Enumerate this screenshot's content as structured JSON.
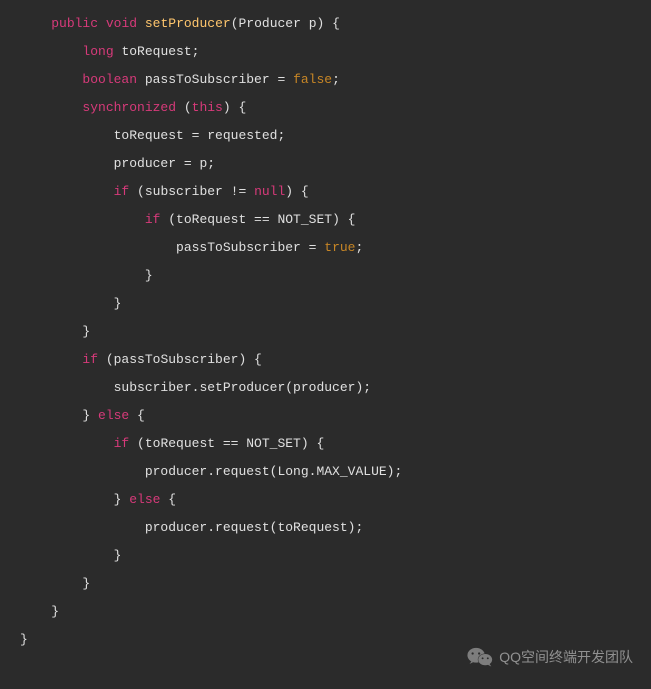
{
  "code": {
    "l1_public": "public",
    "l1_void": "void",
    "l1_method": "setProducer",
    "l1_params": "(Producer p) {",
    "l2_long": "long",
    "l2_rest": " toRequest;",
    "l3_boolean": "boolean",
    "l3_rest": " passToSubscriber = ",
    "l3_false": "false",
    "l3_semi": ";",
    "l4_sync": "synchronized",
    "l4_rest1": " (",
    "l4_this": "this",
    "l4_rest2": ") {",
    "l5": "toRequest = requested;",
    "l6": "producer = p;",
    "l7_if": "if",
    "l7_rest1": " (subscriber != ",
    "l7_null": "null",
    "l7_rest2": ") {",
    "l8_if": "if",
    "l8_rest": " (toRequest == NOT_SET) {",
    "l9_rest1": "passToSubscriber = ",
    "l9_true": "true",
    "l9_semi": ";",
    "l10": "}",
    "l11": "}",
    "l12": "}",
    "l13_if": "if",
    "l13_rest": " (passToSubscriber) {",
    "l14": "subscriber.setProducer(producer);",
    "l15_rest1": "} ",
    "l15_else": "else",
    "l15_rest2": " {",
    "l16_if": "if",
    "l16_rest": " (toRequest == NOT_SET) {",
    "l17": "producer.request(Long.MAX_VALUE);",
    "l18_rest1": "} ",
    "l18_else": "else",
    "l18_rest2": " {",
    "l19": "producer.request(toRequest);",
    "l20": "}",
    "l21": "}",
    "l22": "}",
    "l23": "}"
  },
  "watermark": {
    "text": "QQ空间终端开发团队"
  }
}
